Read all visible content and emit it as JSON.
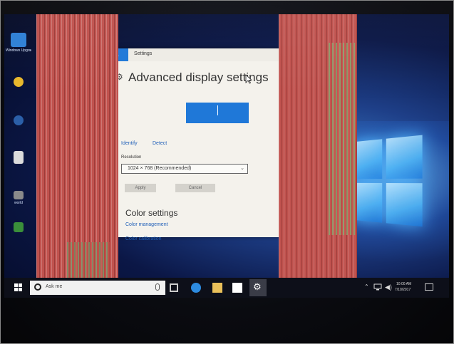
{
  "desktop": {
    "icons": [
      {
        "label": "Windows Upgrad",
        "icon": "windows-icon",
        "color": "#2e7fd6"
      },
      {
        "label": "",
        "icon": "yellow-app-icon",
        "color": "#e8b82c"
      },
      {
        "label": "",
        "icon": "disc-app-icon",
        "color": "#2b5fa8"
      },
      {
        "label": "",
        "icon": "document-icon",
        "color": "#dcdcdc"
      },
      {
        "label": "world",
        "icon": "network-app-icon",
        "color": "#8a8a8a"
      },
      {
        "label": "",
        "icon": "green-app-icon",
        "color": "#3a8f3a"
      }
    ]
  },
  "settings_window": {
    "back_label": "←",
    "title": "Settings",
    "page_title": "Advanced display settings",
    "identify_label": "Identify",
    "detect_label": "Detect",
    "resolution_label": "Resolution",
    "resolution_value": "1024 × 768 (Recommended)",
    "apply_label": "Apply",
    "cancel_label": "Cancel",
    "color_settings_heading": "Color settings",
    "color_management_label": "Color management",
    "color_calibration_label": "Color calibration"
  },
  "taskbar": {
    "search_placeholder": "Ask me",
    "clock_time": "10:00 AM",
    "clock_date": "7/10/2017"
  },
  "colors": {
    "accent": "#1f78d8",
    "stripe_red": "#c0524e",
    "stripe_green": "#78be78",
    "taskbar": "#0d0f19"
  }
}
